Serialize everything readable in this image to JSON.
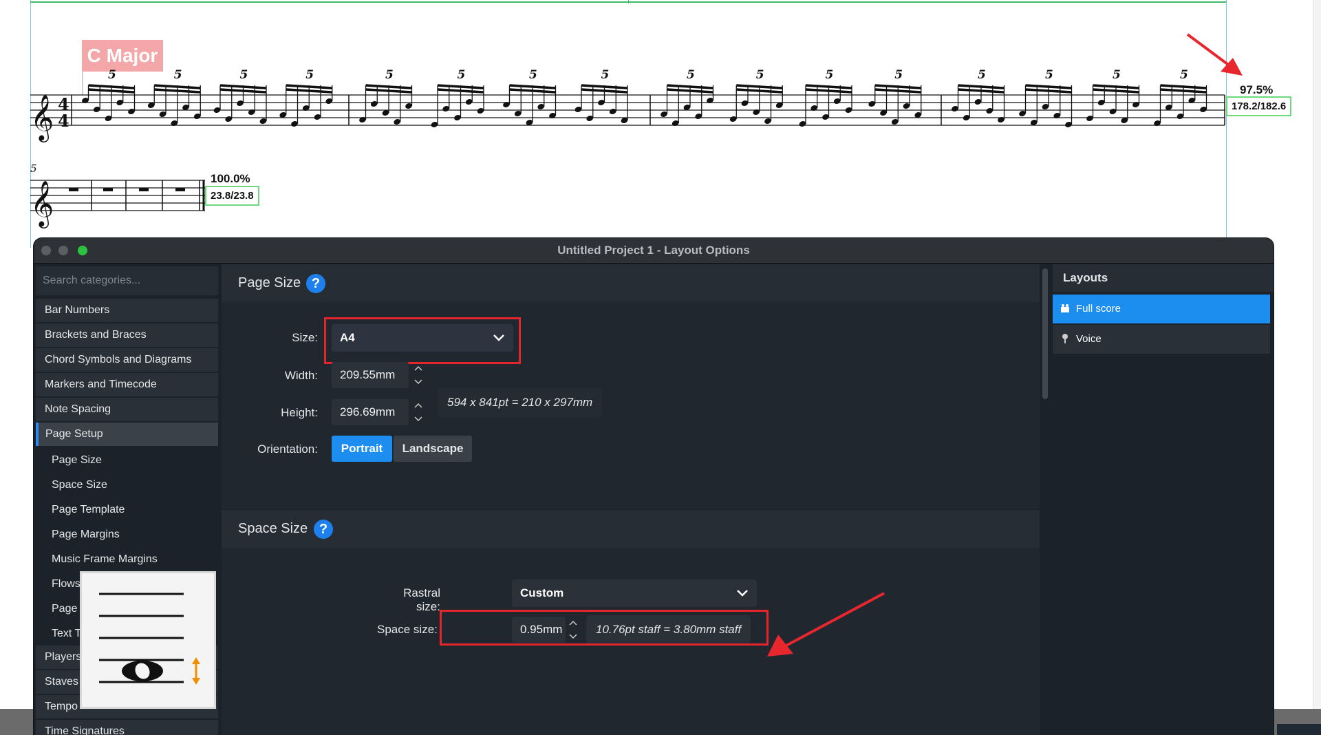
{
  "score": {
    "key_signature_label": "C Major",
    "time_signature": "4/4",
    "tuplet_number": "5",
    "system1": {
      "percent": "97.5%",
      "ratio": "178.2/182.6"
    },
    "system2": {
      "bar_number": "5",
      "percent": "100.0%",
      "ratio": "23.8/23.8"
    }
  },
  "dialog": {
    "title": "Untitled Project 1 - Layout Options",
    "search_placeholder": "Search categories...",
    "categories": [
      {
        "label": "Bar Numbers"
      },
      {
        "label": "Brackets and Braces"
      },
      {
        "label": "Chord Symbols and Diagrams"
      },
      {
        "label": "Markers and Timecode"
      },
      {
        "label": "Note Spacing"
      },
      {
        "label": "Page Setup",
        "selected": true
      },
      {
        "label": "Page Size"
      },
      {
        "label": "Space Size"
      },
      {
        "label": "Page Template"
      },
      {
        "label": "Page Margins"
      },
      {
        "label": "Music Frame Margins"
      },
      {
        "label": "Flows"
      },
      {
        "label": "Page Numbers"
      },
      {
        "label": "Text Tokens"
      },
      {
        "label": "Players"
      },
      {
        "label": "Staves and Systems"
      },
      {
        "label": "Tempo"
      },
      {
        "label": "Time Signatures"
      }
    ],
    "page_size": {
      "title": "Page Size",
      "help": "?",
      "size_label": "Size:",
      "size_value": "A4",
      "width_label": "Width:",
      "width_value": "209.55mm",
      "height_label": "Height:",
      "height_value": "296.69mm",
      "dimensions_hint": "594 x 841pt = 210 x 297mm",
      "orientation_label": "Orientation:",
      "orientation_options": [
        "Portrait",
        "Landscape"
      ],
      "orientation_selected": "Portrait"
    },
    "space_size": {
      "title": "Space Size",
      "help": "?",
      "rastral_label": "Rastral size:",
      "rastral_value": "Custom",
      "space_label": "Space size:",
      "space_value": "0.95mm",
      "staff_hint": "10.76pt staff = 3.80mm staff"
    },
    "layouts": {
      "header": "Layouts",
      "items": [
        {
          "label": "Full score",
          "selected": true,
          "icon": "full-score-icon"
        },
        {
          "label": "Voice",
          "selected": false,
          "icon": "voice-part-icon"
        }
      ]
    }
  },
  "colors": {
    "accent": "#1d8ef0",
    "highlight_box": "#e5242b",
    "annotation_arrow": "#e8262e",
    "key_label_bg": "#f4a7a9",
    "casting_off_box": "#6cd97c"
  }
}
